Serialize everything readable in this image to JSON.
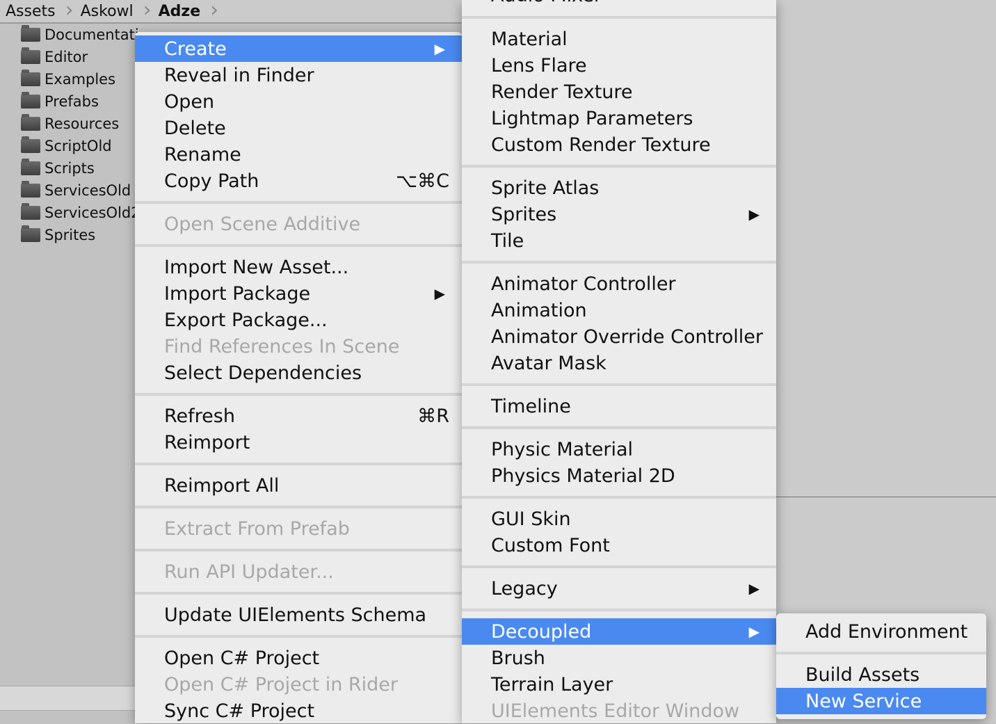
{
  "breadcrumb": [
    "Assets",
    "Askowl",
    "Adze"
  ],
  "folders": [
    "Documentati",
    "Editor",
    "Examples",
    "Prefabs",
    "Resources",
    "ScriptOld",
    "Scripts",
    "ServicesOld",
    "ServicesOld2",
    "Sprites"
  ],
  "context_menu": {
    "create": "Create",
    "reveal_in_finder": "Reveal in Finder",
    "open": "Open",
    "delete": "Delete",
    "rename": "Rename",
    "copy_path": "Copy Path",
    "copy_path_shortcut": "⌥⌘C",
    "open_scene_additive": "Open Scene Additive",
    "import_new_asset": "Import New Asset...",
    "import_package": "Import Package",
    "export_package": "Export Package...",
    "find_references": "Find References In Scene",
    "select_dependencies": "Select Dependencies",
    "refresh": "Refresh",
    "refresh_shortcut": "⌘R",
    "reimport": "Reimport",
    "reimport_all": "Reimport All",
    "extract_from_prefab": "Extract From Prefab",
    "run_api_updater": "Run API Updater...",
    "update_uielements_schema": "Update UIElements Schema",
    "open_csharp_project": "Open C# Project",
    "open_csharp_project_rider": "Open C# Project in Rider",
    "sync_csharp_project": "Sync C# Project"
  },
  "create_submenu": {
    "audio_mixer": "Audio Mixer",
    "material": "Material",
    "lens_flare": "Lens Flare",
    "render_texture": "Render Texture",
    "lightmap_parameters": "Lightmap Parameters",
    "custom_render_texture": "Custom Render Texture",
    "sprite_atlas": "Sprite Atlas",
    "sprites": "Sprites",
    "tile": "Tile",
    "animator_controller": "Animator Controller",
    "animation": "Animation",
    "animator_override_controller": "Animator Override Controller",
    "avatar_mask": "Avatar Mask",
    "timeline": "Timeline",
    "physic_material": "Physic Material",
    "physics_material_2d": "Physics Material 2D",
    "gui_skin": "GUI Skin",
    "custom_font": "Custom Font",
    "legacy": "Legacy",
    "decoupled": "Decoupled",
    "brush": "Brush",
    "terrain_layer": "Terrain Layer",
    "uielements_editor_window": "UIElements Editor Window"
  },
  "decoupled_submenu": {
    "add_environment": "Add Environment",
    "build_assets": "Build Assets",
    "new_service": "New Service"
  },
  "colors": {
    "highlight": "#4a8af0",
    "menu_bg": "#ececec",
    "disabled_text": "#a8a8a8"
  },
  "icons": {
    "submenu_arrow": "▶"
  }
}
